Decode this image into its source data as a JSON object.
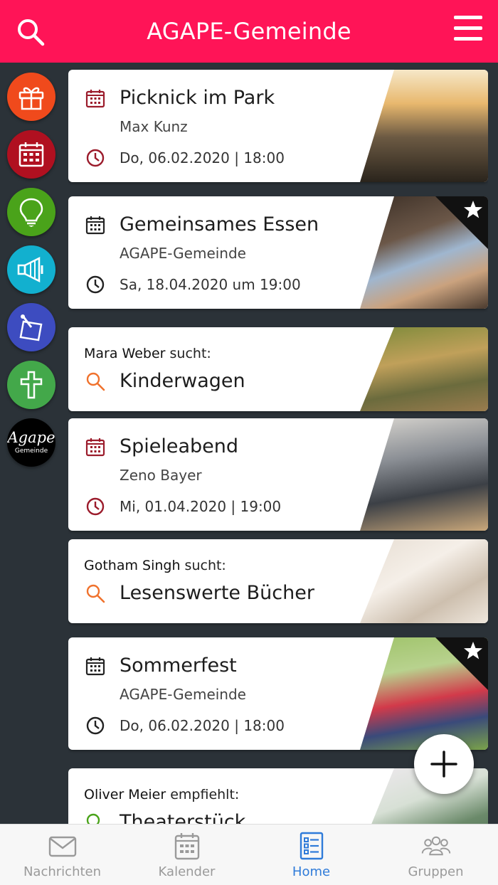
{
  "app": {
    "title": "AGAPE-Gemeinde"
  },
  "colors": {
    "brand": "#ff1457",
    "sidebar": "#2b3238",
    "active_tab": "#2f7bd9",
    "search_accent": "#f0722d",
    "event_icon": "#9b1b2b"
  },
  "sidebar": [
    {
      "name": "gift",
      "color": "#f04a1c"
    },
    {
      "name": "calendar",
      "color": "#b01020"
    },
    {
      "name": "lightbulb",
      "color": "#4aa31a"
    },
    {
      "name": "megaphone",
      "color": "#12b0cf"
    },
    {
      "name": "note",
      "color": "#3d4cc0"
    },
    {
      "name": "cross",
      "color": "#43a84a"
    },
    {
      "name": "agape-logo",
      "color": "#000000",
      "logo_text": "Agape",
      "logo_sub": "Gemeinde"
    }
  ],
  "feed": {
    "card1": {
      "title": "Picknick im Park",
      "subtitle": "Max Kunz",
      "date": "Do, 06.02.2020 | 18:00"
    },
    "card2": {
      "title": "Gemeinsames Essen",
      "subtitle": "AGAPE-Gemeinde",
      "date": "Sa, 18.04.2020 um 19:00",
      "favorite": true
    },
    "card3": {
      "person": "Mara Weber",
      "verb": " sucht:",
      "title": "Kinderwagen"
    },
    "card4": {
      "title": "Spieleabend",
      "subtitle": "Zeno Bayer",
      "date": "Mi, 01.04.2020 | 19:00"
    },
    "card5": {
      "person": "Gotham Singh",
      "verb": " sucht:",
      "title": "Lesenswerte Bücher"
    },
    "card6": {
      "title": "Sommerfest",
      "subtitle": "AGAPE-Gemeinde",
      "date": "Do, 06.02.2020 | 18:00",
      "favorite": true
    },
    "card7": {
      "person": "Oliver Meier",
      "verb": " empfiehlt:",
      "title": "Theaterstück"
    }
  },
  "tabs": {
    "messages": "Nachrichten",
    "calendar": "Kalender",
    "home": "Home",
    "groups": "Gruppen"
  }
}
